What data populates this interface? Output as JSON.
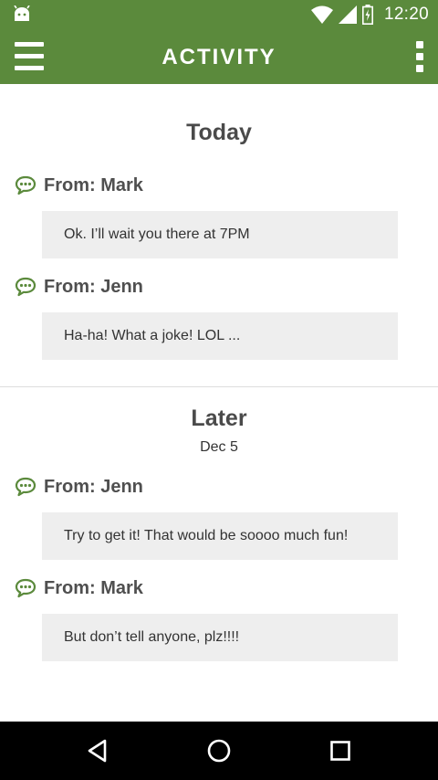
{
  "status_bar": {
    "time": "12:20",
    "icons": [
      "android-icon",
      "wifi-icon",
      "signal-icon",
      "battery-charging-icon"
    ]
  },
  "app_bar": {
    "title": "ACTIVITY",
    "left_icon": "hamburger-menu-icon",
    "right_icon": "overflow-menu-icon"
  },
  "sections": [
    {
      "title": "Today",
      "messages": [
        {
          "from": "From: Mark",
          "text": "Ok. I’ll wait you there at 7PM"
        },
        {
          "from": "From: Jenn",
          "text": "Ha-ha! What a joke! LOL ..."
        }
      ]
    },
    {
      "title": "Later",
      "date": "Dec 5",
      "messages": [
        {
          "from": "From: Jenn",
          "text": "Try to get it! That would be soooo much fun!"
        },
        {
          "from": "From: Mark",
          "text": "But don’t tell anyone, plz!!!!"
        }
      ]
    }
  ],
  "nav_bar": {
    "icons": [
      "back-icon",
      "home-icon",
      "recents-icon"
    ]
  },
  "colors": {
    "accent": "#5b8a3c",
    "bubble": "#eeeeee",
    "nav_bar": "#000000"
  }
}
